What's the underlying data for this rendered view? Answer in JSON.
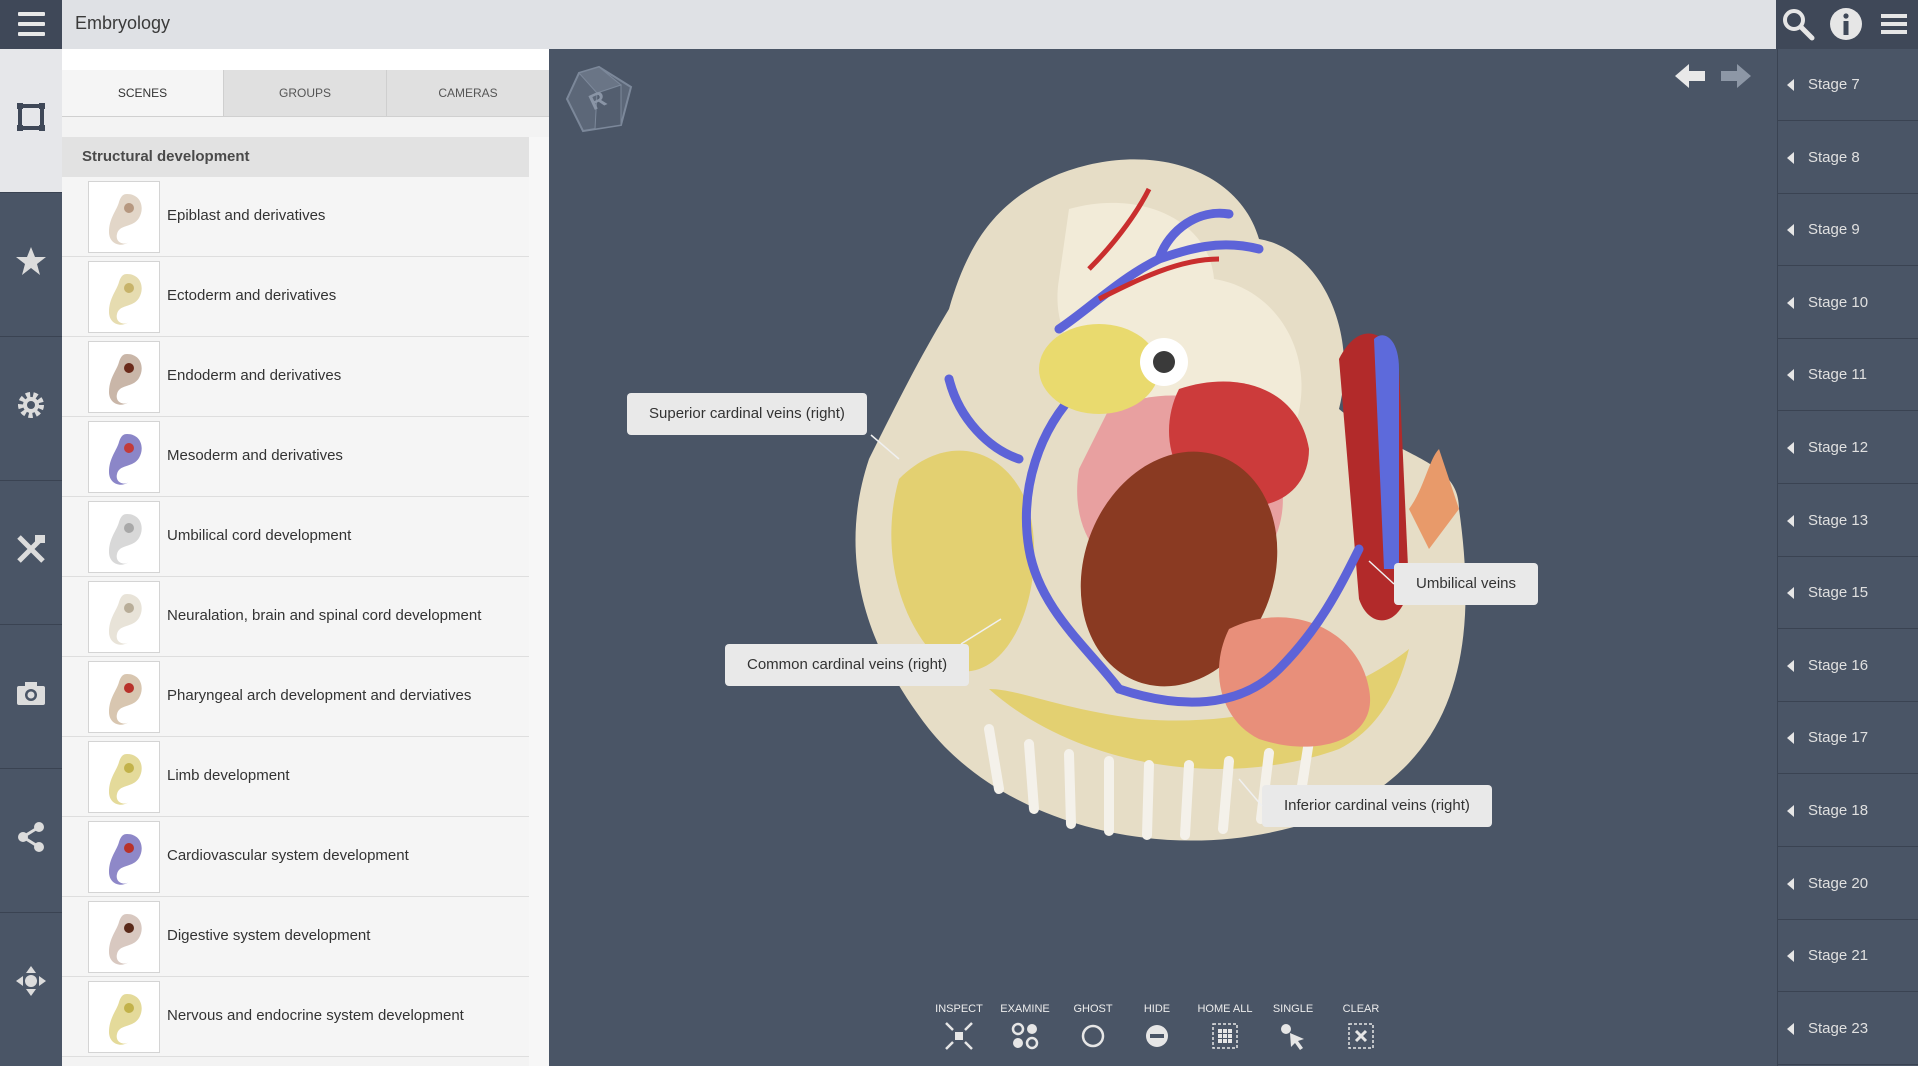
{
  "app": {
    "title": "Embryology"
  },
  "tabs": [
    {
      "label": "SCENES",
      "active": true
    },
    {
      "label": "GROUPS",
      "active": false
    },
    {
      "label": "CAMERAS",
      "active": false
    }
  ],
  "scene_group": {
    "title": "Structural development"
  },
  "scenes": [
    {
      "label": "Epiblast and derivatives"
    },
    {
      "label": "Ectoderm and derivatives"
    },
    {
      "label": "Endoderm and derivatives"
    },
    {
      "label": "Mesoderm and derivatives"
    },
    {
      "label": "Umbilical cord development"
    },
    {
      "label": "Neuralation, brain and spinal cord development"
    },
    {
      "label": "Pharyngeal arch development and derviatives"
    },
    {
      "label": "Limb development"
    },
    {
      "label": "Cardiovascular system development"
    },
    {
      "label": "Digestive system development"
    },
    {
      "label": "Nervous and endocrine system development"
    }
  ],
  "callouts": [
    {
      "label": "Superior cardinal veins (right)"
    },
    {
      "label": "Umbilical veins"
    },
    {
      "label": "Common cardinal veins (right)"
    },
    {
      "label": "Inferior cardinal veins (right)"
    }
  ],
  "toolbar": [
    {
      "label": "INSPECT",
      "icon": "inspect-icon"
    },
    {
      "label": "EXAMINE",
      "icon": "examine-icon"
    },
    {
      "label": "GHOST",
      "icon": "ghost-icon"
    },
    {
      "label": "HIDE",
      "icon": "hide-icon"
    },
    {
      "label": "HOME ALL",
      "icon": "home-all-icon"
    },
    {
      "label": "SINGLE",
      "icon": "single-icon"
    },
    {
      "label": "CLEAR",
      "icon": "clear-icon"
    }
  ],
  "stages": [
    {
      "label": "Stage 7"
    },
    {
      "label": "Stage 8"
    },
    {
      "label": "Stage 9"
    },
    {
      "label": "Stage 10"
    },
    {
      "label": "Stage 11"
    },
    {
      "label": "Stage 12"
    },
    {
      "label": "Stage 13"
    },
    {
      "label": "Stage 15"
    },
    {
      "label": "Stage 16"
    },
    {
      "label": "Stage 17"
    },
    {
      "label": "Stage 18"
    },
    {
      "label": "Stage 20"
    },
    {
      "label": "Stage 21"
    },
    {
      "label": "Stage 23"
    }
  ],
  "left_nav": [
    {
      "icon": "scenes-icon",
      "active": true
    },
    {
      "icon": "star-icon",
      "active": false
    },
    {
      "icon": "gear-icon",
      "active": false
    },
    {
      "icon": "tools-icon",
      "active": false
    },
    {
      "icon": "camera-icon",
      "active": false
    },
    {
      "icon": "share-icon",
      "active": false
    },
    {
      "icon": "move-icon",
      "active": false
    }
  ],
  "colors": {
    "viewport_bg": "#4a5566",
    "panel_bg": "#f3f3f3",
    "topbar_bg": "#dfe1e5",
    "accent_dark": "#3f4858"
  }
}
